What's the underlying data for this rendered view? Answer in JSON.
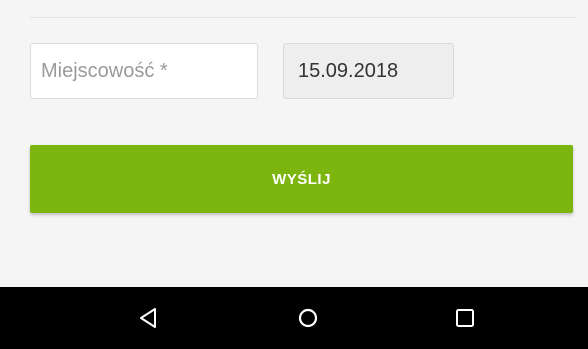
{
  "form": {
    "city_placeholder": "Miejscowość *",
    "city_value": "",
    "date_value": "15.09.2018",
    "submit_label": "WYŚLIJ"
  },
  "nav": {
    "back_icon": "back-triangle-icon",
    "home_icon": "home-circle-icon",
    "recents_icon": "recents-square-icon"
  },
  "colors": {
    "accent": "#7bb50e",
    "background": "#f5f5f5",
    "nav_bar": "#000000"
  }
}
